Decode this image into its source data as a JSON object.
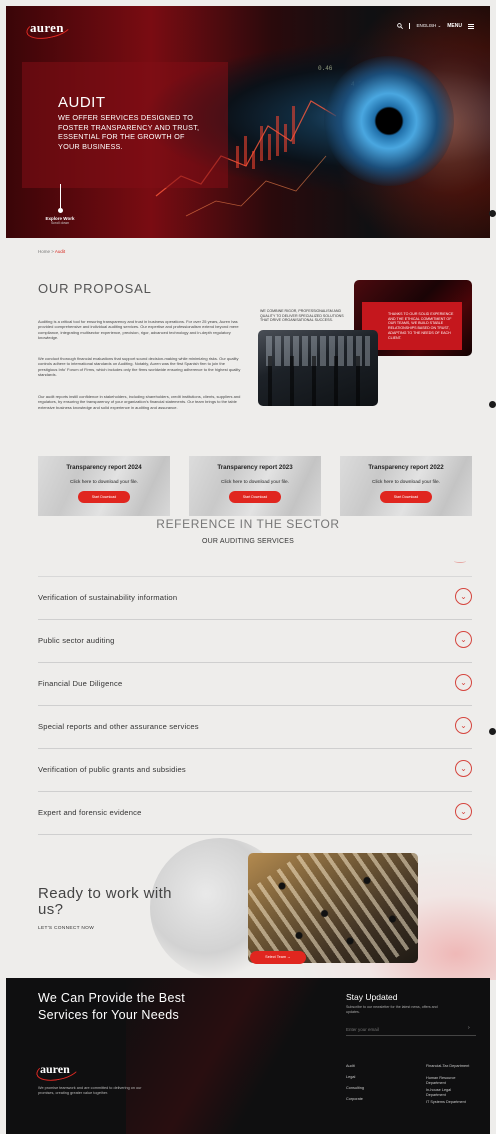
{
  "header": {
    "logo": "auren",
    "language": "ENGLISH",
    "menu": "MENU"
  },
  "hero": {
    "title": "AUDIT",
    "subtitle": "WE OFFER SERVICES DESIGNED TO FOSTER TRANSPARENCY AND TRUST, ESSENTIAL FOR THE GROWTH OF YOUR BUSINESS.",
    "explore_title": "Explore Work",
    "explore_sub": "Scroll down"
  },
  "breadcrumb": {
    "home": "Home",
    "sep": " > ",
    "current": "Audit"
  },
  "proposal": {
    "title": "OUR PROPOSAL",
    "paragraphs": [
      "Auditing is a critical tool for ensuring transparency and trust in business operations. For over 25 years, Auren has provided comprehensive and individual auditing services. Our expertise and professionalism extend beyond mere compliance, integrating multisector experience, precision, rigor, advanced technology and in-depth regulatory knowledge.",
      "We conduct thorough financial evaluations that support sound decision-making while minimizing risks. Our quality controls adhere to international standards on Auditing. Notably, Auren was the first Spanish firm to join the prestigious Info' Forum of Firms, which includes only the firms worldwide ensuring adherence to the highest quality standards.",
      "Our audit reports instill confidence in stakeholders, including shareholders, credit institutions, clients, suppliers and regulators, by ensuring the transparency of your organization's financial statements. Our team brings to the table extensive business knowledge and solid experience in auditing and assurance."
    ],
    "combine_text": "WE COMBINE RIGOR, PROFESSIONALISM AND QUALITY TO DELIVER SPECIALIZED SOLUTIONS THAT DRIVE ORGANISATIONAL SUCCESS.",
    "card_text": "THANKS TO OUR SOLID EXPERIENCE AND THE ETHICAL COMMITMENT OF OUR TEAMS, WE BUILD STABLE RELATIONSHIPS BASED ON TRUST, ADAPTING TO THE NEEDS OF EACH CLIENT."
  },
  "reports": [
    {
      "title": "Transparency report 2024",
      "text": "Click here to download your file.",
      "button": "Start Download"
    },
    {
      "title": "Transparency report 2023",
      "text": "Click here to download your file.",
      "button": "Start Download"
    },
    {
      "title": "Transparency report 2022",
      "text": "Click here to download your file.",
      "button": "Start Download"
    }
  ],
  "services": {
    "title": "REFERENCE IN THE SECTOR",
    "subtitle": "OUR AUDITING SERVICES",
    "items": [
      "Verification of sustainability information",
      "Public sector auditing",
      "Financial Due Diligence",
      "Special reports and other assurance services",
      "Verification of public grants and subsidies",
      "Expert and forensic evidence"
    ]
  },
  "ready": {
    "title": "Ready to work with us?",
    "subtitle": "LET'S CONNECT NOW",
    "button": "Select Team"
  },
  "footer": {
    "title": "We Can Provide the Best Services for Your Needs",
    "logo": "auren",
    "about": "We promise teamwork and are committed to delivering on our promises, creating greater value together.",
    "stay_title": "Stay Updated",
    "stay_sub": "Subscribe to our newsletter for the latest news, offers and updates.",
    "email_placeholder": "Enter your email",
    "links_col1": [
      "Audit",
      "Legal",
      "Consulting",
      "Corporate"
    ],
    "links_col2": [
      "Financial-Tax Department",
      "Human Resource Department",
      "In-house Legal Department",
      "IT Systems Department"
    ]
  },
  "colors": {
    "accent": "#e0261f",
    "footer_bg": "#0f0f10",
    "page_bg": "#eeedeb"
  }
}
